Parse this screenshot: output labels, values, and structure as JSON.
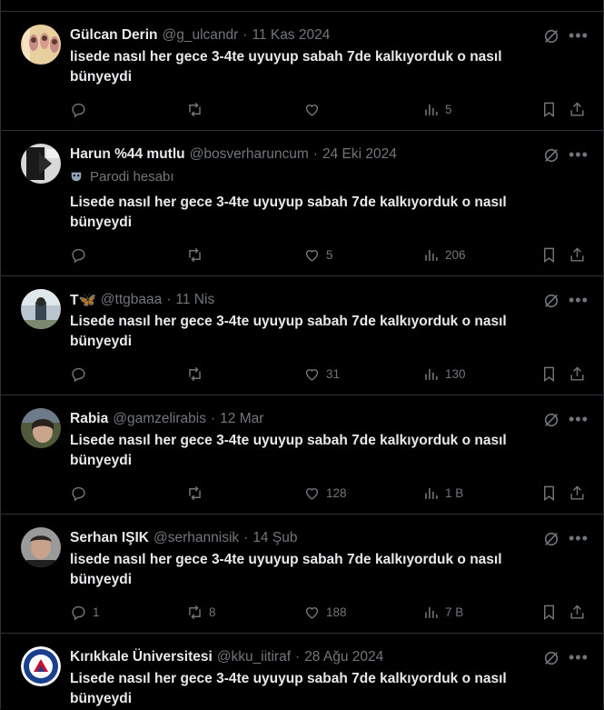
{
  "colors": {
    "background": "#000000",
    "text": "#e7e9ea",
    "muted": "#71767b",
    "border": "#2f3336"
  },
  "tweets": [
    {
      "name": "Gülcan Derin",
      "handle": "@g_ulcandr",
      "date": "11 Kas 2024",
      "text": "lisede nasıl her gece 3-4te uyuyup sabah 7de kalkıyorduk o nasıl bünyeydi",
      "replies": "",
      "retweets": "",
      "likes": "",
      "views": "5"
    },
    {
      "name": "Harun %44 mutlu",
      "handle": "@bosverharuncum",
      "date": "24 Eki 2024",
      "badge": "Parodi hesabı",
      "text": "Lisede nasıl her gece 3-4te uyuyup sabah 7de kalkıyorduk o nasıl bünyeydi",
      "replies": "",
      "retweets": "",
      "likes": "5",
      "views": "206"
    },
    {
      "name": "T🦋",
      "handle": "@ttgbaaa",
      "date": "11 Nis",
      "text": "Lisede nasıl her gece 3-4te uyuyup sabah 7de kalkıyorduk o nasıl bünyeydi",
      "replies": "",
      "retweets": "",
      "likes": "31",
      "views": "130"
    },
    {
      "name": "Rabia",
      "handle": "@gamzelirabis",
      "date": "12 Mar",
      "text": "Lisede nasıl her gece 3-4te uyuyup sabah 7de kalkıyorduk o nasıl bünyeydi",
      "replies": "",
      "retweets": "",
      "likes": "128",
      "views": "1 B"
    },
    {
      "name": "Serhan IŞIK",
      "handle": "@serhannisik",
      "date": "14 Şub",
      "text": "lisede nasıl her gece 3-4te uyuyup sabah 7de kalkıyorduk o nasıl bünyeydi",
      "replies": "1",
      "retweets": "8",
      "likes": "188",
      "views": "7 B"
    },
    {
      "name": "Kırıkkale Üniversitesi",
      "handle": "@kku_iitiraf",
      "date": "28 Ağu 2024",
      "text": "Lisede nasıl her gece 3-4te uyuyup sabah 7de kalkıyorduk o nasıl bünyeydi",
      "replies": "",
      "retweets": "",
      "likes": "",
      "views": ""
    }
  ],
  "icons": {
    "reply": "reply-icon",
    "retweet": "retweet-icon",
    "like": "heart-icon",
    "views": "analytics-icon",
    "bookmark": "bookmark-icon",
    "share": "share-icon",
    "grok": "grok-icon",
    "more": "more-icon",
    "parody": "parody-mask-icon"
  }
}
